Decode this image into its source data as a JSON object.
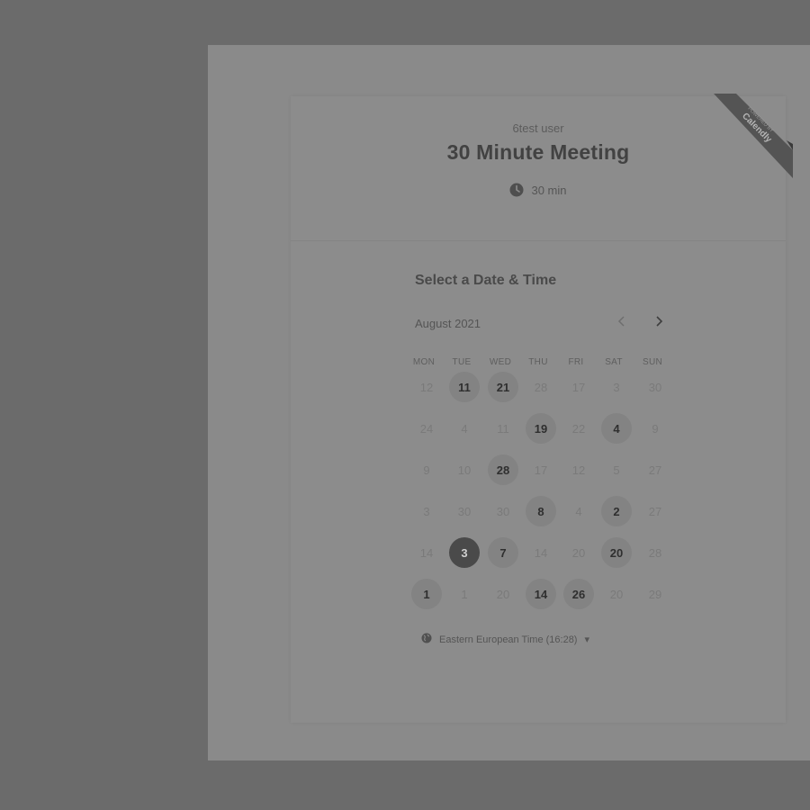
{
  "event": {
    "organizer": "6test user",
    "title": "30 Minute Meeting",
    "duration": "30 min"
  },
  "ribbon": {
    "line1": "POWERED BY",
    "line2": "Calendly"
  },
  "calendar": {
    "section_title": "Select a Date & Time",
    "month": "August 2021",
    "weekdays": [
      "MON",
      "TUE",
      "WED",
      "THU",
      "FRI",
      "SAT",
      "SUN"
    ],
    "rows": [
      [
        {
          "d": "12",
          "s": "disabled"
        },
        {
          "d": "11",
          "s": "available"
        },
        {
          "d": "21",
          "s": "available"
        },
        {
          "d": "28",
          "s": "disabled"
        },
        {
          "d": "17",
          "s": "disabled"
        },
        {
          "d": "3",
          "s": "disabled"
        },
        {
          "d": "30",
          "s": "disabled"
        }
      ],
      [
        {
          "d": "24",
          "s": "disabled"
        },
        {
          "d": "4",
          "s": "disabled"
        },
        {
          "d": "11",
          "s": "disabled"
        },
        {
          "d": "19",
          "s": "available"
        },
        {
          "d": "22",
          "s": "disabled"
        },
        {
          "d": "4",
          "s": "available"
        },
        {
          "d": "9",
          "s": "disabled"
        }
      ],
      [
        {
          "d": "9",
          "s": "disabled"
        },
        {
          "d": "10",
          "s": "disabled"
        },
        {
          "d": "28",
          "s": "available"
        },
        {
          "d": "17",
          "s": "disabled"
        },
        {
          "d": "12",
          "s": "disabled"
        },
        {
          "d": "5",
          "s": "disabled"
        },
        {
          "d": "27",
          "s": "disabled"
        }
      ],
      [
        {
          "d": "3",
          "s": "disabled"
        },
        {
          "d": "30",
          "s": "disabled"
        },
        {
          "d": "30",
          "s": "disabled"
        },
        {
          "d": "8",
          "s": "available"
        },
        {
          "d": "4",
          "s": "disabled"
        },
        {
          "d": "2",
          "s": "available"
        },
        {
          "d": "27",
          "s": "disabled"
        }
      ],
      [
        {
          "d": "14",
          "s": "disabled"
        },
        {
          "d": "3",
          "s": "selected"
        },
        {
          "d": "7",
          "s": "available"
        },
        {
          "d": "14",
          "s": "disabled"
        },
        {
          "d": "20",
          "s": "disabled"
        },
        {
          "d": "20",
          "s": "available"
        },
        {
          "d": "28",
          "s": "disabled"
        }
      ],
      [
        {
          "d": "1",
          "s": "available"
        },
        {
          "d": "1",
          "s": "disabled"
        },
        {
          "d": "20",
          "s": "disabled"
        },
        {
          "d": "14",
          "s": "available"
        },
        {
          "d": "26",
          "s": "available"
        },
        {
          "d": "20",
          "s": "disabled"
        },
        {
          "d": "29",
          "s": "disabled"
        }
      ]
    ]
  },
  "timezone": {
    "label": "Eastern European Time (16:28)",
    "caret": "▾"
  },
  "icons": {
    "clock": "clock-icon",
    "globe": "globe-icon",
    "prev": "chevron-left-icon",
    "next": "chevron-right-icon"
  }
}
